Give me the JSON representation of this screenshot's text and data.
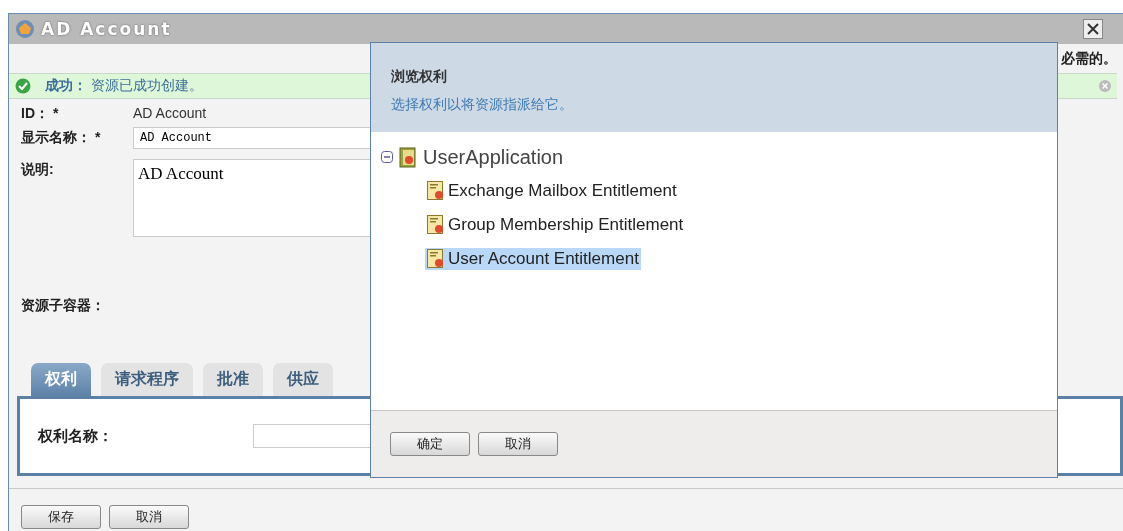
{
  "window": {
    "title": "AD Account",
    "required_note": "必需的。"
  },
  "message": {
    "label": "成功：",
    "text": "资源已成功创建。"
  },
  "form": {
    "id_label": "ID： *",
    "id_value": "AD Account",
    "display_name_label": "显示名称： *",
    "display_name_value": "AD Account",
    "description_label": "说明:",
    "description_value": "AD Account",
    "container_label": "资源子容器："
  },
  "tabs": [
    {
      "label": "权利",
      "selected": true
    },
    {
      "label": "请求程序",
      "selected": false
    },
    {
      "label": "批准",
      "selected": false
    },
    {
      "label": "供应",
      "selected": false
    }
  ],
  "tab_panel": {
    "label": "权利名称："
  },
  "buttons": [
    "保存",
    "取消"
  ],
  "dialog": {
    "title": "浏览权利",
    "subtitle": "选择权利以将资源指派给它。",
    "tree": [
      {
        "label": "UserApplication",
        "expanded": true,
        "selected": false,
        "children": [
          {
            "label": "Exchange Mailbox Entitlement",
            "selected": false
          },
          {
            "label": "Group Membership Entitlement",
            "selected": false
          },
          {
            "label": "User Account Entitlement",
            "selected": true
          }
        ]
      }
    ],
    "buttons": [
      "确定",
      "取消"
    ]
  }
}
